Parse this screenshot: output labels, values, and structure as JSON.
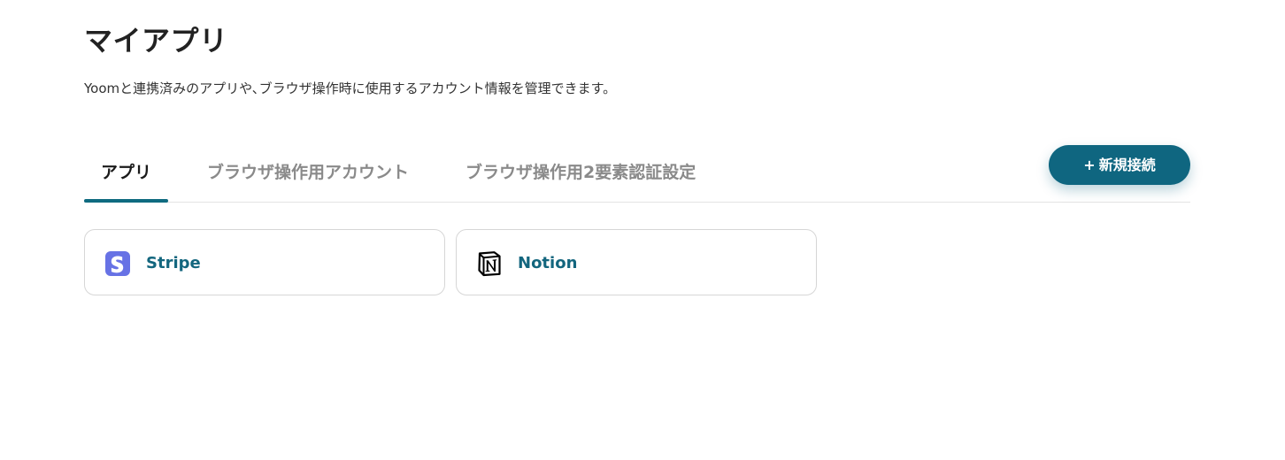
{
  "page": {
    "title": "マイアプリ",
    "description": "Yoomと連携済みのアプリや､ブラウザ操作時に使用するアカウント情報を管理できます。"
  },
  "tabs": [
    {
      "label": "アプリ",
      "active": true
    },
    {
      "label": "ブラウザ操作用アカウント",
      "active": false
    },
    {
      "label": "ブラウザ操作用2要素認証設定",
      "active": false
    }
  ],
  "actions": {
    "new_connection_plus": "+",
    "new_connection_label": "新規接続"
  },
  "apps": [
    {
      "name": "Stripe",
      "icon": "stripe-logo-icon",
      "icon_color": "#6772e5"
    },
    {
      "name": "Notion",
      "icon": "notion-logo-icon",
      "icon_color": "#000000"
    }
  ],
  "colors": {
    "accent": "#0f6680",
    "app_name": "#13667e",
    "tab_inactive": "#8a8a8a"
  }
}
